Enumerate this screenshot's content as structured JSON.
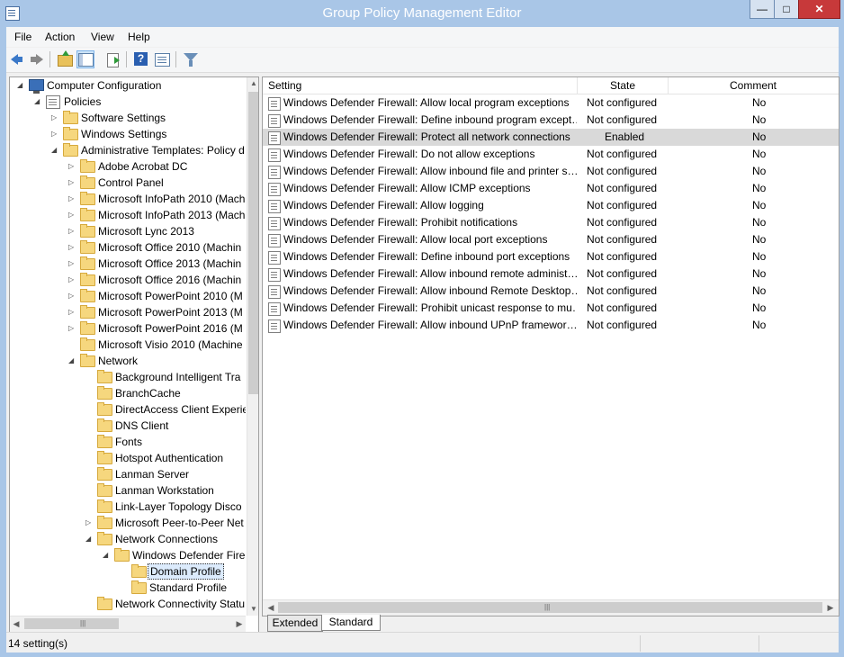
{
  "window": {
    "title": "Group Policy Management Editor",
    "min_glyph": "—",
    "max_glyph": "□",
    "close_glyph": "✕"
  },
  "menu": {
    "file": "File",
    "action": "Action",
    "view": "View",
    "help": "Help"
  },
  "toolbar": {
    "icons": [
      "back-arrow-icon",
      "forward-arrow-icon",
      "up-folder-icon",
      "show-hide-tree-icon",
      "export-list-icon",
      "help-icon",
      "properties-icon",
      "filter-icon"
    ],
    "help_glyph": "?"
  },
  "tree": {
    "items": [
      {
        "label": "Computer Configuration",
        "expander": "◢"
      },
      {
        "label": "Policies",
        "expander": "◢"
      },
      {
        "label": "Software Settings",
        "expander": "▷"
      },
      {
        "label": "Windows Settings",
        "expander": "▷"
      },
      {
        "label": "Administrative Templates: Policy d",
        "expander": "◢"
      },
      {
        "label": "Adobe Acrobat DC",
        "expander": "▷"
      },
      {
        "label": "Control Panel",
        "expander": "▷"
      },
      {
        "label": "Microsoft InfoPath 2010 (Mach",
        "expander": "▷"
      },
      {
        "label": "Microsoft InfoPath 2013 (Mach",
        "expander": "▷"
      },
      {
        "label": "Microsoft Lync 2013",
        "expander": "▷"
      },
      {
        "label": "Microsoft Office 2010 (Machin",
        "expander": "▷"
      },
      {
        "label": "Microsoft Office 2013 (Machin",
        "expander": "▷"
      },
      {
        "label": "Microsoft Office 2016 (Machin",
        "expander": "▷"
      },
      {
        "label": "Microsoft PowerPoint 2010 (M",
        "expander": "▷"
      },
      {
        "label": "Microsoft PowerPoint 2013 (M",
        "expander": "▷"
      },
      {
        "label": "Microsoft PowerPoint 2016 (M",
        "expander": "▷"
      },
      {
        "label": "Microsoft Visio 2010 (Machine",
        "expander": ""
      },
      {
        "label": "Network",
        "expander": "◢"
      },
      {
        "label": "Background Intelligent Tra",
        "expander": ""
      },
      {
        "label": "BranchCache",
        "expander": ""
      },
      {
        "label": "DirectAccess Client Experie",
        "expander": ""
      },
      {
        "label": "DNS Client",
        "expander": ""
      },
      {
        "label": "Fonts",
        "expander": ""
      },
      {
        "label": "Hotspot Authentication",
        "expander": ""
      },
      {
        "label": "Lanman Server",
        "expander": ""
      },
      {
        "label": "Lanman Workstation",
        "expander": ""
      },
      {
        "label": "Link-Layer Topology Disco",
        "expander": ""
      },
      {
        "label": "Microsoft Peer-to-Peer Net",
        "expander": "▷"
      },
      {
        "label": "Network Connections",
        "expander": "◢"
      },
      {
        "label": "Windows Defender Fire",
        "expander": "◢"
      },
      {
        "label": "Domain Profile",
        "expander": ""
      },
      {
        "label": "Standard Profile",
        "expander": ""
      },
      {
        "label": "Network Connectivity Statu",
        "expander": ""
      }
    ],
    "scroll_up": "▲",
    "scroll_down": "▼",
    "scroll_left": "◀",
    "scroll_right": "▶",
    "grip": "|||"
  },
  "list": {
    "columns": {
      "setting": "Setting",
      "state": "State",
      "comment": "Comment"
    },
    "rows": [
      {
        "setting": "Windows Defender Firewall: Allow local program exceptions",
        "state": "Not configured",
        "comment": "No"
      },
      {
        "setting": "Windows Defender Firewall: Define inbound program exceptions",
        "state": "Not configured",
        "comment": "No"
      },
      {
        "setting": "Windows Defender Firewall: Protect all network connections",
        "state": "Enabled",
        "comment": "No"
      },
      {
        "setting": "Windows Defender Firewall: Do not allow exceptions",
        "state": "Not configured",
        "comment": "No"
      },
      {
        "setting": "Windows Defender Firewall: Allow inbound file and printer sharing exception",
        "state": "Not configured",
        "comment": "No"
      },
      {
        "setting": "Windows Defender Firewall: Allow ICMP exceptions",
        "state": "Not configured",
        "comment": "No"
      },
      {
        "setting": "Windows Defender Firewall: Allow logging",
        "state": "Not configured",
        "comment": "No"
      },
      {
        "setting": "Windows Defender Firewall: Prohibit notifications",
        "state": "Not configured",
        "comment": "No"
      },
      {
        "setting": "Windows Defender Firewall: Allow local port exceptions",
        "state": "Not configured",
        "comment": "No"
      },
      {
        "setting": "Windows Defender Firewall: Define inbound port exceptions",
        "state": "Not configured",
        "comment": "No"
      },
      {
        "setting": "Windows Defender Firewall: Allow inbound remote administration exception",
        "state": "Not configured",
        "comment": "No"
      },
      {
        "setting": "Windows Defender Firewall: Allow inbound Remote Desktop exceptions",
        "state": "Not configured",
        "comment": "No"
      },
      {
        "setting": "Windows Defender Firewall: Prohibit unicast response to multicast or broadcast requests",
        "state": "Not configured",
        "comment": "No"
      },
      {
        "setting": "Windows Defender Firewall: Allow inbound UPnP framework exceptions",
        "state": "Not configured",
        "comment": "No"
      }
    ],
    "display": [
      "Windows Defender Firewall: Allow local program exceptions",
      "Windows Defender Firewall: Define inbound program except…",
      "Windows Defender Firewall: Protect all network connections",
      "Windows Defender Firewall: Do not allow exceptions",
      "Windows Defender Firewall: Allow inbound file and printer s…",
      "Windows Defender Firewall: Allow ICMP exceptions",
      "Windows Defender Firewall: Allow logging",
      "Windows Defender Firewall: Prohibit notifications",
      "Windows Defender Firewall: Allow local port exceptions",
      "Windows Defender Firewall: Define inbound port exceptions",
      "Windows Defender Firewall: Allow inbound remote administ…",
      "Windows Defender Firewall: Allow inbound Remote Desktop…",
      "Windows Defender Firewall: Prohibit unicast response to mu…",
      "Windows Defender Firewall: Allow inbound UPnP framewor…"
    ]
  },
  "tabs": {
    "extended": "Extended",
    "standard": "Standard"
  },
  "status": {
    "text": "14 setting(s)"
  },
  "colors": {
    "titlebar": "#a9c6e7",
    "close": "#c7393a",
    "selected_row": "#d9d9d9"
  }
}
